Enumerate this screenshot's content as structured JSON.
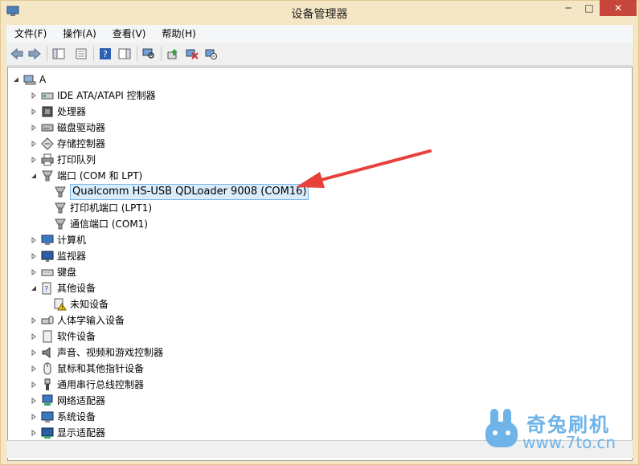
{
  "window": {
    "title": "设备管理器",
    "controls": {
      "minimize": "─",
      "maximize": "□",
      "close": "✕"
    }
  },
  "menu": [
    "文件(F)",
    "操作(A)",
    "查看(V)",
    "帮助(H)"
  ],
  "toolbar": [
    "back-icon",
    "forward-icon",
    "show-hide-console-tree-icon",
    "properties-icon",
    "help-icon",
    "action-pane-icon",
    "scan-hardware-icon",
    "update-driver-icon",
    "disable-device-icon",
    "uninstall-device-icon"
  ],
  "tree": {
    "root": "A",
    "categories": [
      {
        "label": "IDE ATA/ATAPI 控制器",
        "expanded": false,
        "icon": "ide-controller-icon"
      },
      {
        "label": "处理器",
        "expanded": false,
        "icon": "processor-icon"
      },
      {
        "label": "磁盘驱动器",
        "expanded": false,
        "icon": "disk-drive-icon"
      },
      {
        "label": "存储控制器",
        "expanded": false,
        "icon": "storage-controller-icon"
      },
      {
        "label": "打印队列",
        "expanded": false,
        "icon": "print-queue-icon"
      },
      {
        "label": "端口 (COM 和 LPT)",
        "expanded": true,
        "icon": "port-icon",
        "children": [
          {
            "label": "Qualcomm HS-USB QDLoader 9008 (COM16)",
            "selected": true,
            "icon": "port-icon"
          },
          {
            "label": "打印机端口 (LPT1)",
            "icon": "port-icon"
          },
          {
            "label": "通信端口 (COM1)",
            "icon": "port-icon"
          }
        ]
      },
      {
        "label": "计算机",
        "expanded": false,
        "icon": "computer-icon"
      },
      {
        "label": "监视器",
        "expanded": false,
        "icon": "monitor-icon"
      },
      {
        "label": "键盘",
        "expanded": false,
        "icon": "keyboard-icon"
      },
      {
        "label": "其他设备",
        "expanded": true,
        "icon": "other-devices-icon",
        "children": [
          {
            "label": "未知设备",
            "icon": "unknown-device-warning-icon"
          }
        ]
      },
      {
        "label": "人体学输入设备",
        "expanded": false,
        "icon": "hid-icon"
      },
      {
        "label": "软件设备",
        "expanded": false,
        "icon": "software-device-icon"
      },
      {
        "label": "声音、视频和游戏控制器",
        "expanded": false,
        "icon": "sound-icon"
      },
      {
        "label": "鼠标和其他指针设备",
        "expanded": false,
        "icon": "mouse-icon"
      },
      {
        "label": "通用串行总线控制器",
        "expanded": false,
        "icon": "usb-icon"
      },
      {
        "label": "网络适配器",
        "expanded": false,
        "icon": "network-adapter-icon"
      },
      {
        "label": "系统设备",
        "expanded": false,
        "icon": "system-device-icon"
      },
      {
        "label": "显示适配器",
        "expanded": false,
        "icon": "display-adapter-icon"
      }
    ]
  },
  "watermark": {
    "brand": "奇兔刷机",
    "url": "www.7to.cn"
  },
  "colors": {
    "frame": "#f5e7c6",
    "close": "#c7463c",
    "selection": "#d9ecfb",
    "arrow": "#e8403a",
    "watermark": "#6fb4e8"
  }
}
